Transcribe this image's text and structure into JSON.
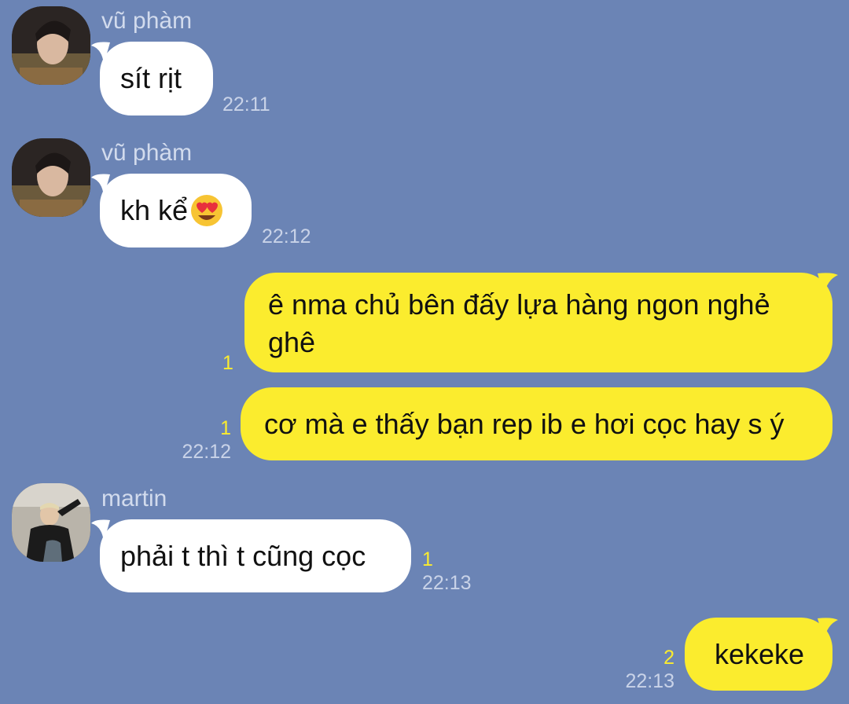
{
  "messages": [
    {
      "sender": "vũ phàm",
      "text": "sít rịt",
      "time": "22:11",
      "read": ""
    },
    {
      "sender": "vũ phàm",
      "text": "kh kể",
      "emoji": "heart-eyes-emoji",
      "time": "22:12",
      "read": ""
    },
    {
      "text": "ê nma chủ bên đấy lựa hàng ngon nghẻ ghê",
      "time": "",
      "read": "1"
    },
    {
      "text": "cơ mà e thấy bạn rep ib e hơi cọc hay s ý",
      "time": "22:12",
      "read": "1"
    },
    {
      "sender": "martin",
      "text": "phải t thì t cũng cọc",
      "time": "22:13",
      "read": "1"
    },
    {
      "text": "kekeke",
      "time": "22:13",
      "read": "2"
    }
  ],
  "colors": {
    "background": "#6b84b5",
    "incoming_bubble": "#ffffff",
    "outgoing_bubble": "#fbec2e",
    "read_count": "#fbec2e",
    "time": "#c9d3e8"
  }
}
